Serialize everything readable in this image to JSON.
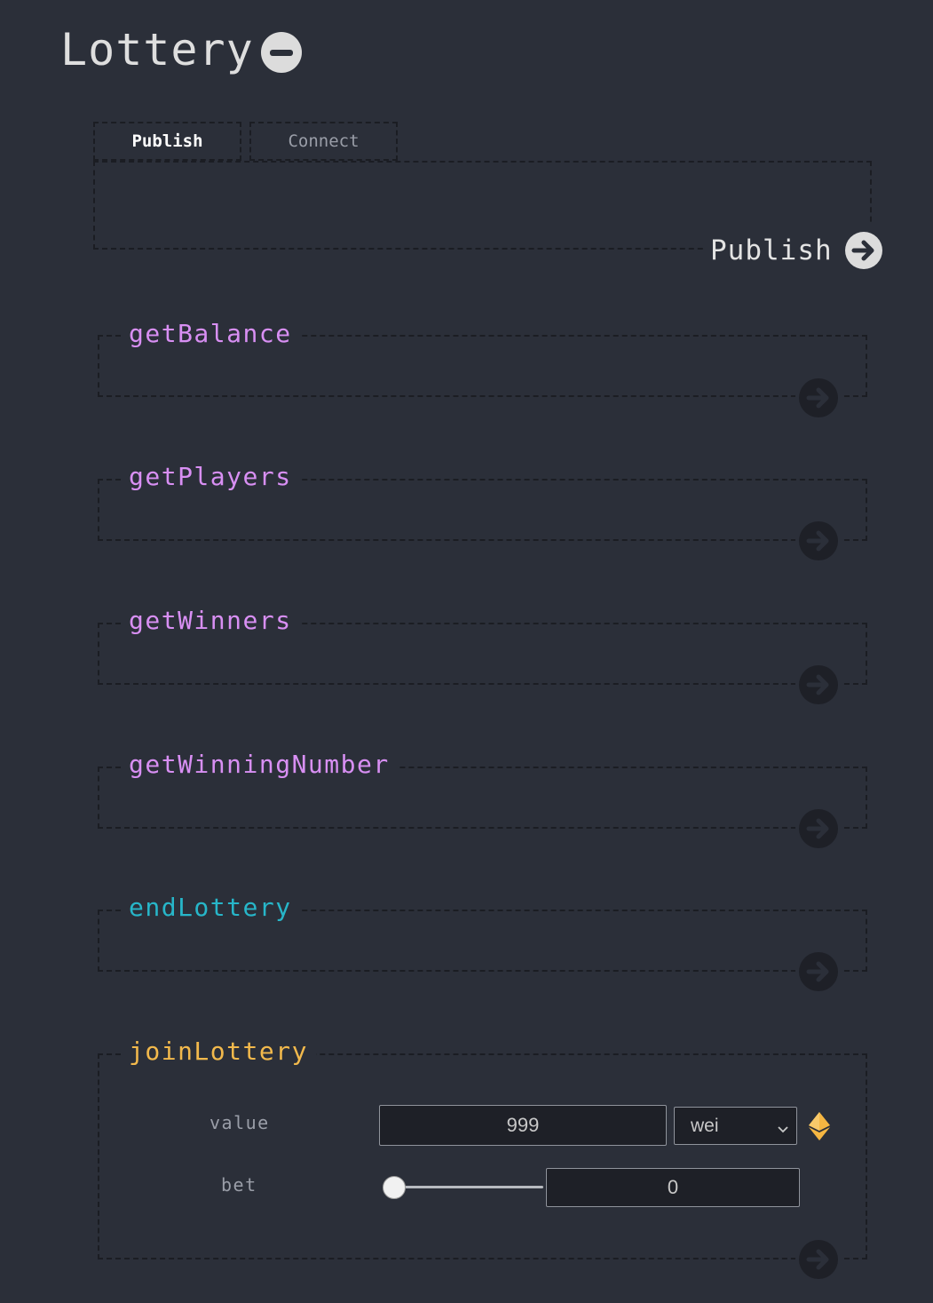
{
  "contract": {
    "title": "Lottery"
  },
  "tabs": [
    {
      "label": "Publish",
      "active": true
    },
    {
      "label": "Connect",
      "active": false
    }
  ],
  "publish": {
    "action_label": "Publish"
  },
  "functions": [
    {
      "name": "getBalance",
      "kind": "view"
    },
    {
      "name": "getPlayers",
      "kind": "view"
    },
    {
      "name": "getWinners",
      "kind": "view"
    },
    {
      "name": "getWinningNumber",
      "kind": "view"
    },
    {
      "name": "endLottery",
      "kind": "nonpayable"
    },
    {
      "name": "joinLottery",
      "kind": "payable"
    }
  ],
  "join_params": {
    "value_label": "value",
    "value_input": "999",
    "unit_selected": "wei",
    "bet_label": "bet",
    "bet_input": "0",
    "bet_slider_fraction": 0.0
  },
  "colors": {
    "background": "#2b2f39",
    "view": "#d88ff3",
    "nonpayable": "#27b6c9",
    "payable": "#f2b94c",
    "eth_icon": "#f5b642"
  },
  "icons": {
    "collapse": "minus-circle-icon",
    "go": "arrow-right-circle-icon",
    "eth": "ethereum-icon",
    "select": "chevron-down-icon"
  }
}
